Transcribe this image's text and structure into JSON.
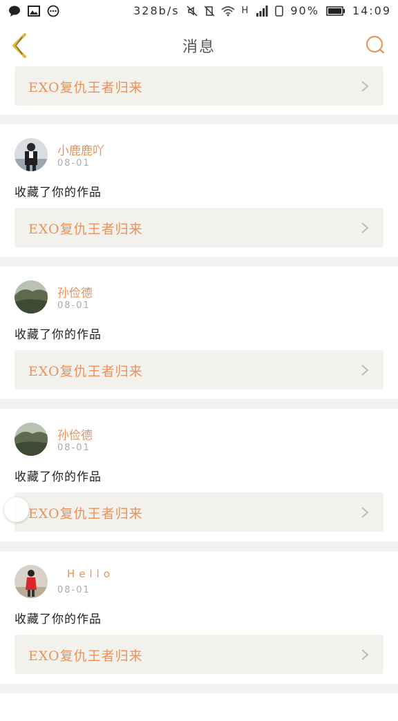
{
  "status_bar": {
    "speed": "328b/s",
    "network": "H",
    "battery": "90%",
    "time": "14:09"
  },
  "header": {
    "title": "消息"
  },
  "top_card": {
    "work_title": "EXO复仇王者归来"
  },
  "notifications": [
    {
      "username": "小鹿鹿吖",
      "date": "08-01",
      "action": "收藏了你的作品",
      "work_title": "EXO复仇王者归来",
      "avatar_icon": "person-photo"
    },
    {
      "username": "孙俭德",
      "date": "08-01",
      "action": "收藏了你的作品",
      "work_title": "EXO复仇王者归来",
      "avatar_icon": "landscape-photo"
    },
    {
      "username": "孙俭德",
      "date": "08-01",
      "action": "收藏了你的作品",
      "work_title": "EXO复仇王者归来",
      "avatar_icon": "landscape-photo"
    },
    {
      "username": "Hello",
      "date": "08-01",
      "action": "收藏了你的作品",
      "work_title": "EXO复仇王者归来",
      "avatar_icon": "person-red-photo"
    }
  ],
  "colors": {
    "accent": "#e8925c",
    "back_arrow": "#e0b93a",
    "card_bg": "#f2f1ec"
  }
}
